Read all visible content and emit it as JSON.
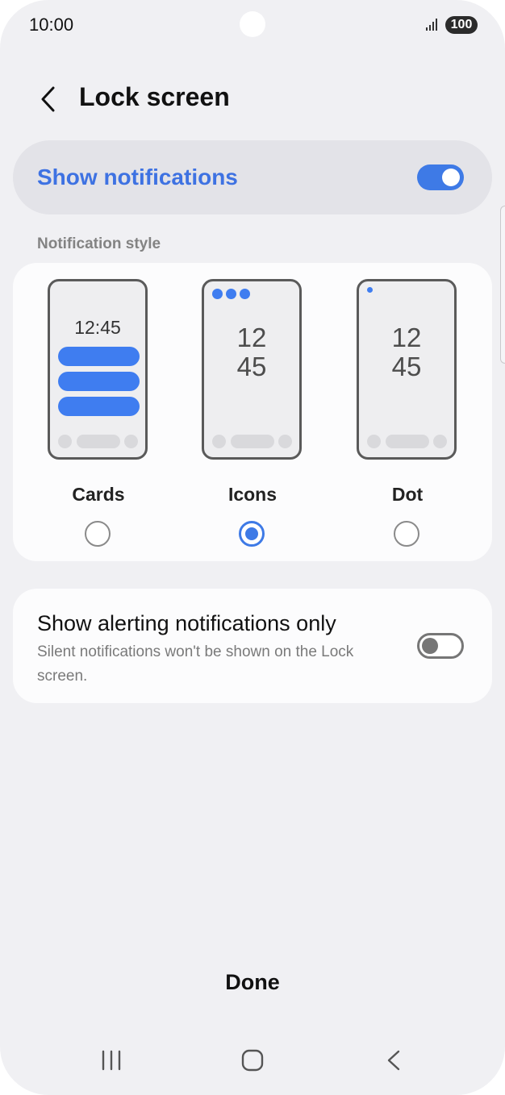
{
  "status_bar": {
    "time": "10:00",
    "battery": "100"
  },
  "header": {
    "title": "Lock screen",
    "back_icon": "chevron-left-icon"
  },
  "master_switch": {
    "label": "Show notifications",
    "enabled": true
  },
  "notification_style": {
    "section_label": "Notification style",
    "options": [
      {
        "label": "Cards",
        "preview_time": "12:45",
        "selected": false
      },
      {
        "label": "Icons",
        "preview_time_hours": "12",
        "preview_time_minutes": "45",
        "selected": true
      },
      {
        "label": "Dot",
        "preview_time_hours": "12",
        "preview_time_minutes": "45",
        "selected": false
      }
    ]
  },
  "alerting_only": {
    "title": "Show alerting notifications only",
    "description": "Silent notifications won't be shown on the Lock screen.",
    "enabled": false
  },
  "done_label": "Done",
  "navigation": {
    "recents_icon": "recents-icon",
    "home_icon": "home-icon",
    "back_icon": "back-icon"
  },
  "colors": {
    "accent": "#3e7ae6",
    "background": "#f0f0f3",
    "card": "#fcfcfd"
  }
}
